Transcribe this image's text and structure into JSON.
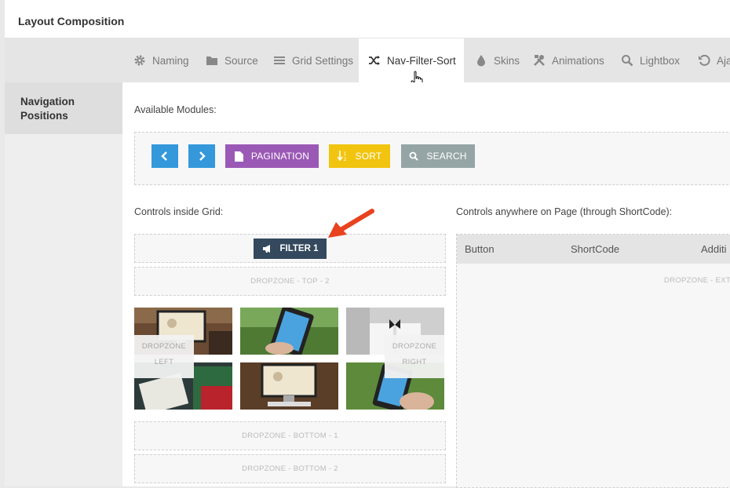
{
  "header": {
    "title": "Layout Composition"
  },
  "tabs": [
    {
      "label": "Naming",
      "icon": "gear-icon"
    },
    {
      "label": "Source",
      "icon": "folder-icon"
    },
    {
      "label": "Grid Settings",
      "icon": "menu-icon"
    },
    {
      "label": "Nav-Filter-Sort",
      "icon": "shuffle-icon",
      "active": true
    },
    {
      "label": "Skins",
      "icon": "droplet-icon"
    },
    {
      "label": "Animations",
      "icon": "tools-icon"
    },
    {
      "label": "Lightbox",
      "icon": "search-icon"
    },
    {
      "label": "Aja",
      "icon": "undo-icon"
    }
  ],
  "sidebar": {
    "items": [
      {
        "label": "Navigation Positions"
      }
    ]
  },
  "main": {
    "available_label": "Available Modules:",
    "modules": [
      {
        "label": "",
        "icon": "chevron-left-icon",
        "color": "#3498db"
      },
      {
        "label": "",
        "icon": "chevron-right-icon",
        "color": "#3498db"
      },
      {
        "label": "PAGINATION",
        "icon": "file-icon",
        "color": "#9b59b6"
      },
      {
        "label": "SORT",
        "icon": "sort-icon",
        "color": "#f1c40f"
      },
      {
        "label": "SEARCH",
        "icon": "search-icon",
        "color": "#95a5a6"
      }
    ],
    "inside_label": "Controls inside Grid:",
    "anywhere_label": "Controls anywhere on Page (through ShortCode):",
    "filter_label": "FILTER 1",
    "dz_top2": "DROPZONE - TOP - 2",
    "dz_left": [
      "DROPZONE",
      "LEFT"
    ],
    "dz_right": [
      "DROPZONE",
      "RIGHT"
    ],
    "dz_bottom1": "DROPZONE - BOTTOM - 1",
    "dz_bottom2": "DROPZONE - BOTTOM - 2",
    "table_headers": [
      "Button",
      "ShortCode",
      "Additi"
    ],
    "dz_external": "DROPZONE - EXTE"
  },
  "colors": {
    "accent_dark": "#34495e",
    "arrow": "#e8421f"
  }
}
